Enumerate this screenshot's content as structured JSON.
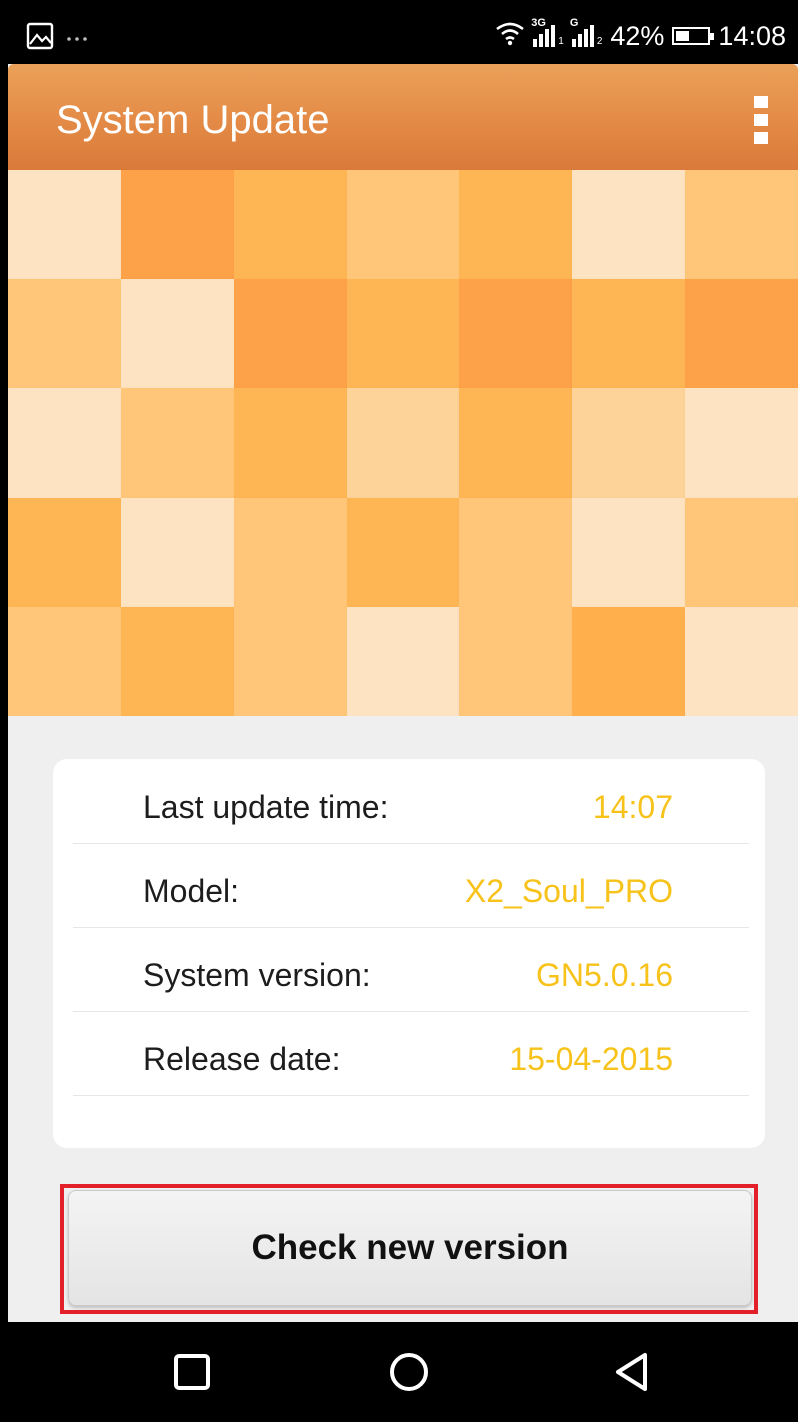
{
  "status_bar": {
    "network_labels": [
      "3G",
      "G"
    ],
    "battery_level": 0.42,
    "battery_text": "42%",
    "time": "14:08",
    "icons": [
      "image-notification-icon",
      "more-dots-icon",
      "wifi-icon",
      "signal-sim1-icon",
      "signal-sim2-icon",
      "battery-icon"
    ]
  },
  "toolbar": {
    "title": "System Update",
    "overflow_icon": "more-vertical-icon"
  },
  "colors": {
    "toolbar": "#e38a46",
    "value_text": "#f7c21a",
    "highlight": "#e3202a",
    "tiles": [
      "#fde3c1",
      "#fea24a",
      "#feb654",
      "#ffc679",
      "#fdd399",
      "#ffaf4c"
    ]
  },
  "mosaic": {
    "grid": [
      [
        0,
        1,
        2,
        3,
        2,
        0,
        3
      ],
      [
        3,
        0,
        1,
        2,
        1,
        2,
        1
      ],
      [
        0,
        3,
        2,
        4,
        2,
        4,
        0
      ],
      [
        2,
        0,
        3,
        2,
        3,
        0,
        3
      ],
      [
        3,
        2,
        3,
        0,
        3,
        5,
        0
      ]
    ]
  },
  "info": {
    "rows": [
      {
        "label": "Last update time:",
        "value": "14:07"
      },
      {
        "label": "Model:",
        "value": "X2_Soul_PRO"
      },
      {
        "label": "System version:",
        "value": "GN5.0.16"
      },
      {
        "label": "Release date:",
        "value": "15-04-2015"
      }
    ]
  },
  "action": {
    "check_label": "Check new version"
  },
  "nav": {
    "icons": [
      "recent-apps-icon",
      "home-icon",
      "back-icon"
    ]
  }
}
